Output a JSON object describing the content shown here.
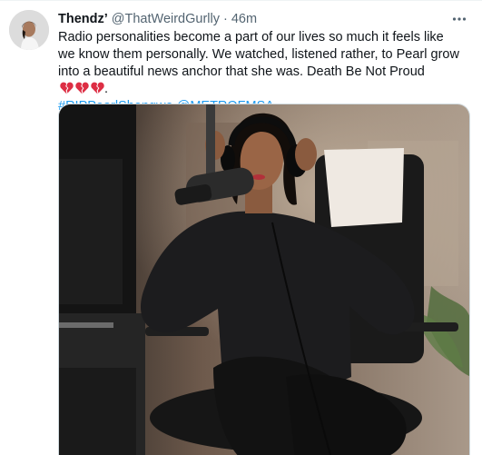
{
  "tweet": {
    "author": {
      "display_name": "Thendz’",
      "handle": "@ThatWeirdGurlly",
      "separator": "·",
      "time": "46m",
      "avatar_icon": "profile-photo"
    },
    "more_icon": "ellipsis-icon",
    "text": {
      "body": "Radio personalities become a part of our lives so much it feels like we know them personally. We watched, listened rather, to Pearl grow into a beautiful news anchor that she was. Death Be Not Proud",
      "emoji": [
        "broken-heart",
        "broken-heart",
        "broken-heart"
      ],
      "after_emoji": ".",
      "hashtag": "#RIPPearlShongwe",
      "mention": "@METROFMSA"
    },
    "media": {
      "icon": "photo"
    },
    "colors": {
      "link": "#1d9bf0",
      "secondary": "#536471",
      "heart": "#e0245e"
    }
  }
}
